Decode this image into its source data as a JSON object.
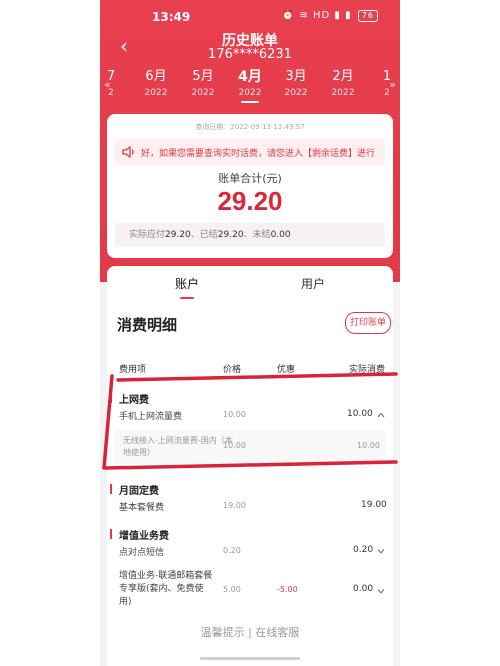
{
  "status": {
    "time": "13:49",
    "icons": "⏰ ≋ HD ▮ ▮",
    "battery": "76"
  },
  "header": {
    "title": "历史账单",
    "phone": "176****6231"
  },
  "months": [
    {
      "m": "7",
      "y": "2"
    },
    {
      "m": "6月",
      "y": "2022"
    },
    {
      "m": "5月",
      "y": "2022"
    },
    {
      "m": "4月",
      "y": "2022"
    },
    {
      "m": "3月",
      "y": "2022"
    },
    {
      "m": "2月",
      "y": "2022"
    },
    {
      "m": "1",
      "y": "2"
    }
  ],
  "bill": {
    "query_time": "查询日期：2022-09-13 13:49:57",
    "notice": "好，如果您需要查询实时话费，请您进入【剩余话费】进行",
    "total_label": "账单合计(元)",
    "total_value": "29.20",
    "due_label": "实际应付",
    "due_value": "29.20",
    "paid_label": "、已结",
    "paid_value": "29.20",
    "unpaid_label": "、未结",
    "unpaid_value": "0.00"
  },
  "tabs": {
    "account": "账户",
    "user": "用户"
  },
  "detail": {
    "title": "消费明细",
    "print": "打印账单",
    "headers": {
      "item": "费用项",
      "price": "价格",
      "discount": "优惠",
      "actual": "实际消费"
    },
    "sections": {
      "internet": {
        "title": "上网费",
        "row_name": "手机上网流量费",
        "row_price": "10.00",
        "row_fee": "10.00",
        "sub_name": "无线接入-上网流量费-国内（本地使用）",
        "sub_price": "10.00",
        "sub_fee": "10.00"
      },
      "monthly": {
        "title": "月固定费",
        "row_name": "基本套餐费",
        "row_price": "19.00",
        "row_fee": "19.00"
      },
      "vas": {
        "title": "增值业务费",
        "row1_name": "点对点短信",
        "row1_price": "0.20",
        "row1_fee": "0.20",
        "row2_name": "增值业务-联通邮箱套餐专享版(套内、免费使用)",
        "row2_price": "5.00",
        "row2_disc": "-5.00",
        "row2_fee": "0.00"
      }
    }
  },
  "footer": {
    "hint": "温馨提示 | 在线客服"
  },
  "colors": {
    "brand": "#e53a4a",
    "annotation": "#d8233a"
  }
}
